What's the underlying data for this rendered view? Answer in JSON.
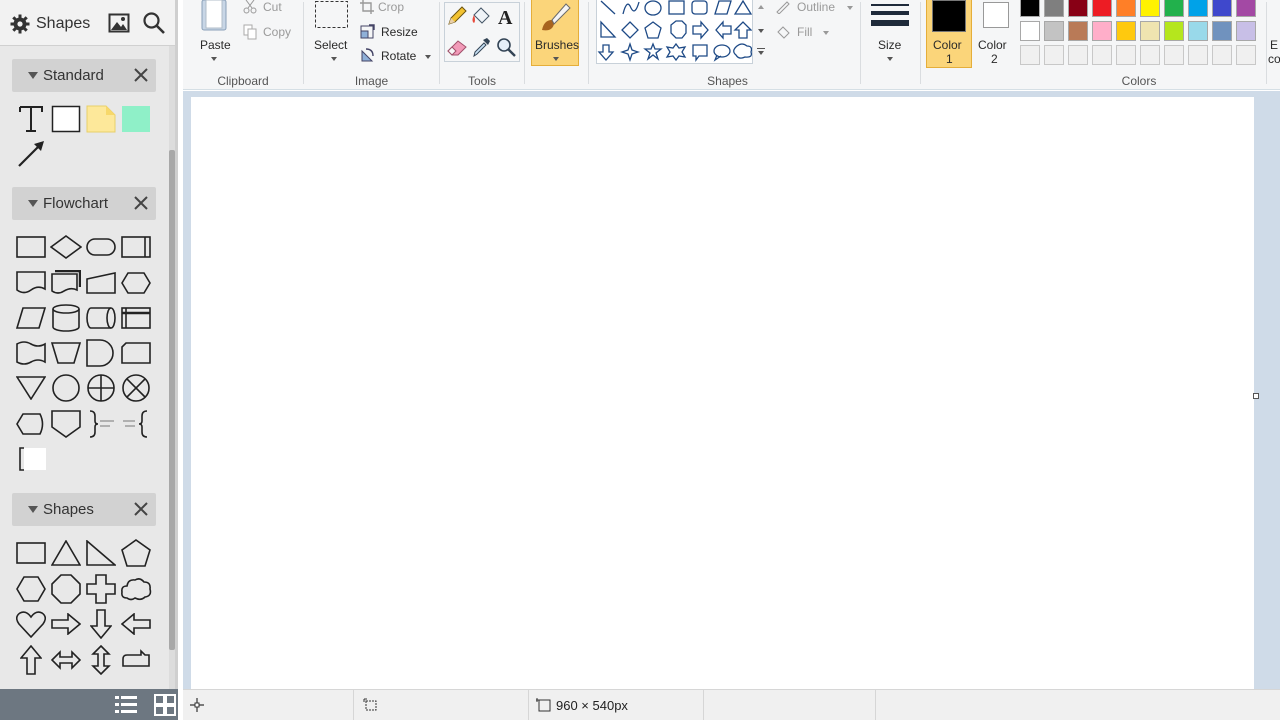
{
  "left_panel": {
    "title": "Shapes",
    "groups": [
      {
        "label": "Standard",
        "shapes": [
          "text-tool",
          "rectangle",
          "note",
          "colored-rectangle",
          "arrow-line"
        ]
      },
      {
        "label": "Flowchart",
        "shapes": [
          "process",
          "decision",
          "terminator",
          "predefined-process",
          "document",
          "multi-document",
          "manual-input",
          "preparation",
          "data",
          "database",
          "direct-data",
          "internal-storage",
          "punched-tape",
          "manual-operation",
          "delay",
          "card",
          "merge",
          "connector",
          "or",
          "summing-junction",
          "display",
          "off-page-connector",
          "brace-left-annotation",
          "brace-right-annotation",
          "bracket-annotation"
        ]
      },
      {
        "label": "Shapes",
        "shapes": [
          "rectangle",
          "triangle",
          "right-triangle",
          "pentagon",
          "hexagon",
          "octagon",
          "cross",
          "cloud",
          "heart",
          "arrow-right",
          "arrow-down",
          "arrow-left",
          "arrow-up",
          "arrow-left-right",
          "arrow-up-down",
          "callout"
        ]
      }
    ]
  },
  "ribbon": {
    "clipboard": {
      "group_label": "Clipboard",
      "paste": "Paste",
      "cut": "Cut",
      "copy": "Copy"
    },
    "image": {
      "group_label": "Image",
      "select": "Select",
      "crop": "Crop",
      "resize": "Resize",
      "rotate": "Rotate"
    },
    "tools": {
      "group_label": "Tools"
    },
    "brushes": {
      "label": "Brushes"
    },
    "shapes": {
      "group_label": "Shapes",
      "outline": "Outline",
      "fill": "Fill"
    },
    "size": {
      "label": "Size"
    },
    "color1": {
      "label": "Color",
      "num": "1"
    },
    "color2": {
      "label": "Color",
      "num": "2"
    },
    "colors": {
      "group_label": "Colors",
      "edit_label_line1": "E",
      "edit_label_line2": "co",
      "row1": [
        "#000000",
        "#7f7f7f",
        "#880015",
        "#ed1c24",
        "#ff7f27",
        "#fff200",
        "#22b14c",
        "#00a2e8",
        "#3f48cc",
        "#a349a4"
      ],
      "row2": [
        "#ffffff",
        "#c3c3c3",
        "#b97a57",
        "#ffaec9",
        "#ffc90e",
        "#efe4b0",
        "#b5e61d",
        "#99d9ea",
        "#7092be",
        "#c8bfe7"
      ],
      "row3": [
        "#f0f0f0",
        "#f0f0f0",
        "#f0f0f0",
        "#f0f0f0",
        "#f0f0f0",
        "#f0f0f0",
        "#f0f0f0",
        "#f0f0f0",
        "#f0f0f0",
        "#f0f0f0"
      ]
    },
    "color1_value": "#000000",
    "color2_value": "#ffffff"
  },
  "statusbar": {
    "canvas_size": "960 × 540px"
  }
}
